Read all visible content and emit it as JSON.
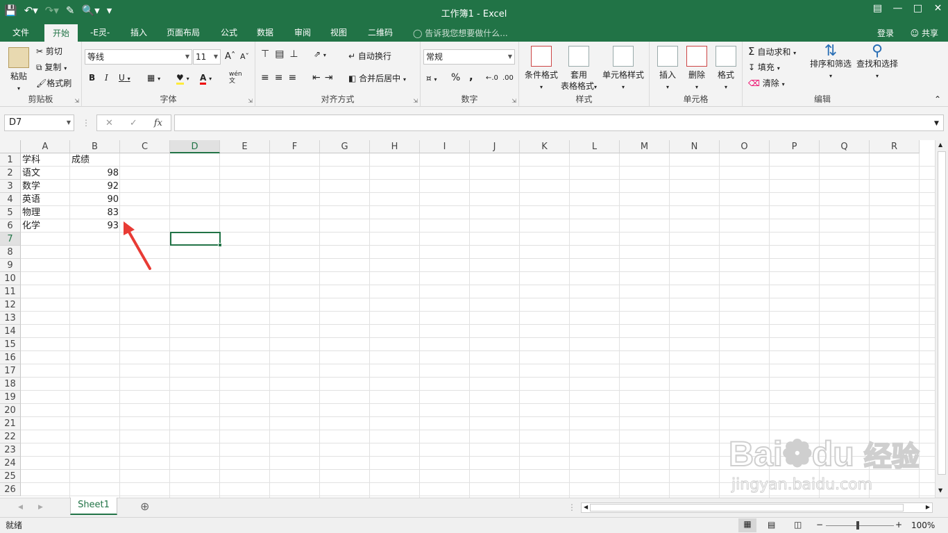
{
  "window": {
    "title": "工作簿1 - Excel"
  },
  "tabs": [
    "文件",
    "开始",
    "-E灵-",
    "插入",
    "页面布局",
    "公式",
    "数据",
    "审阅",
    "视图",
    "二维码"
  ],
  "active_tab": "开始",
  "tell_me": "告诉我您想要做什么...",
  "login": "登录",
  "share": "共享",
  "ribbon": {
    "clipboard": {
      "label": "剪贴板",
      "paste": "粘贴",
      "cut": "剪切",
      "copy": "复制",
      "format_painter": "格式刷"
    },
    "font": {
      "label": "字体",
      "font_name": "等线",
      "font_size": "11",
      "bold": "B",
      "italic": "I",
      "underline": "U",
      "phonetic": "wén"
    },
    "alignment": {
      "label": "对齐方式",
      "wrap": "自动换行",
      "merge": "合并后居中"
    },
    "number": {
      "label": "数字",
      "format": "常规",
      "percent": "%",
      "comma": ","
    },
    "styles": {
      "label": "样式",
      "conditional": "条件格式",
      "table_format_1": "套用",
      "table_format_2": "表格格式",
      "cell_styles": "单元格样式"
    },
    "cells": {
      "label": "单元格",
      "insert": "插入",
      "delete": "删除",
      "format": "格式"
    },
    "editing": {
      "label": "编辑",
      "autosum": "自动求和",
      "fill": "填充",
      "clear": "清除",
      "sort": "排序和筛选",
      "find": "查找和选择"
    }
  },
  "formula_bar": {
    "name_box": "D7",
    "fx": "fx",
    "content": ""
  },
  "columns": [
    "A",
    "B",
    "C",
    "D",
    "E",
    "F",
    "G",
    "H",
    "I",
    "J",
    "K",
    "L",
    "M",
    "N",
    "O",
    "P",
    "Q",
    "R"
  ],
  "rows": [
    "1",
    "2",
    "3",
    "4",
    "5",
    "6",
    "7",
    "8",
    "9",
    "10",
    "11",
    "12",
    "13",
    "14",
    "15",
    "16",
    "17",
    "18",
    "19",
    "20",
    "21",
    "22",
    "23",
    "24",
    "25",
    "26"
  ],
  "cells": {
    "A1": "学科",
    "B1": "成绩",
    "A2": "语文",
    "B2": "98",
    "A3": "数学",
    "B3": "92",
    "A4": "英语",
    "B4": "90",
    "A5": "物理",
    "B5": "83",
    "A6": "化学",
    "B6": "93"
  },
  "active_cell": "D7",
  "sheet": {
    "name": "Sheet1"
  },
  "status": {
    "ready": "就绪",
    "zoom": "100%"
  },
  "watermark": {
    "brand": "Bai",
    "brand2": "du",
    "cn": "经验",
    "url": "jingyan.baidu.com"
  },
  "colors": {
    "excel_green": "#217346",
    "arrow_red": "#e83b35"
  }
}
